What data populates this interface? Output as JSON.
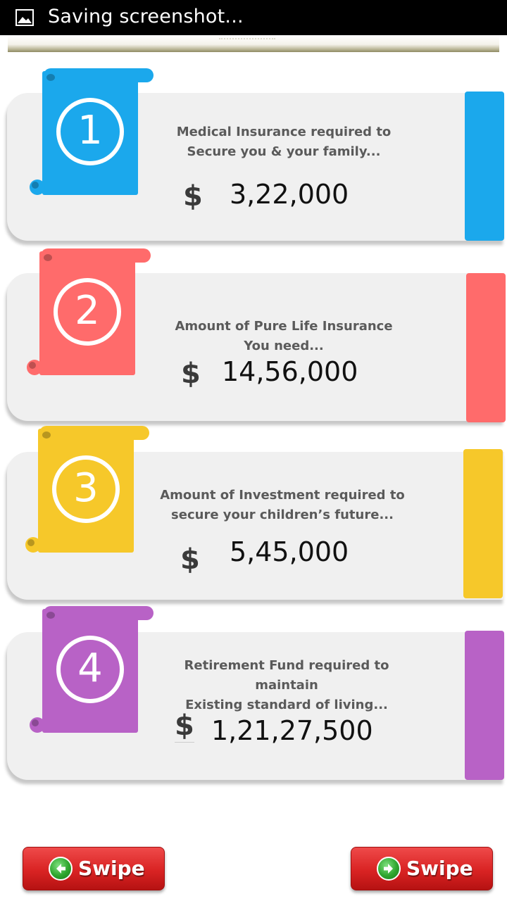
{
  "status_bar": {
    "text": "Saving screenshot..."
  },
  "cards": [
    {
      "number": "1",
      "description": [
        "Medical Insurance required to",
        "Secure you & your family..."
      ],
      "currency": "$",
      "amount": "3,22,000",
      "color": "#1ba8ec"
    },
    {
      "number": "2",
      "description": [
        "Amount of Pure Life Insurance",
        "You need..."
      ],
      "currency": "$",
      "amount": "14,56,000",
      "color": "#ff6b6b"
    },
    {
      "number": "3",
      "description": [
        "Amount of Investment required to",
        "secure your children’s future..."
      ],
      "currency": "$",
      "amount": "5,45,000",
      "color": "#f6c82a"
    },
    {
      "number": "4",
      "description": [
        "Retirement Fund required to maintain",
        "Existing standard of living..."
      ],
      "currency": "$",
      "amount": "1,21,27,500",
      "color": "#b862c6"
    }
  ],
  "buttons": {
    "swipe_left": "Swipe",
    "swipe_right": "Swipe"
  }
}
